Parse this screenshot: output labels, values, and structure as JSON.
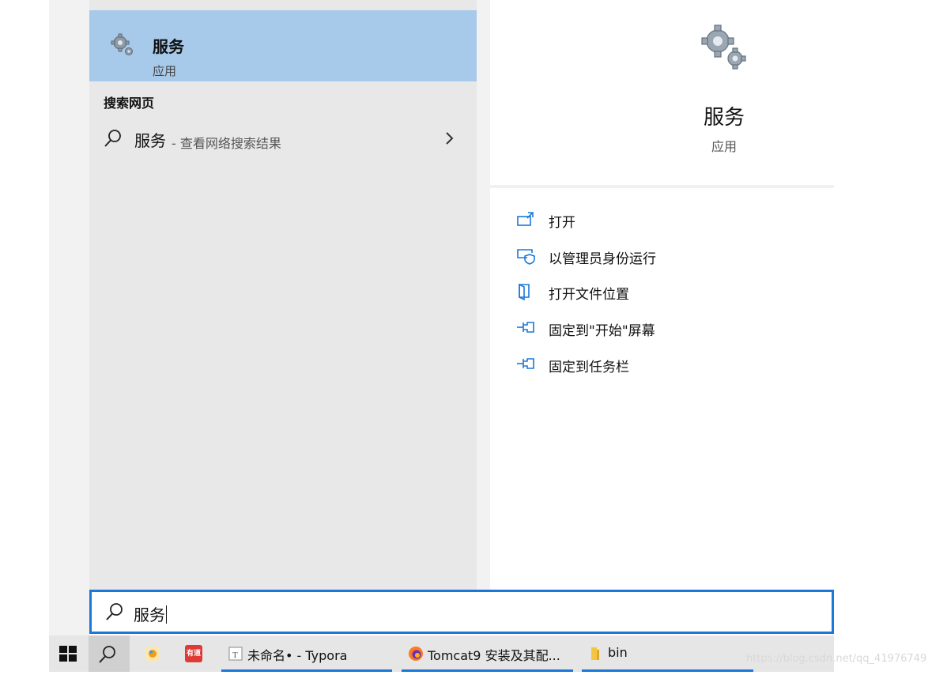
{
  "best_match": {
    "title": "服务",
    "subtitle": "应用"
  },
  "web_section": {
    "heading": "搜索网页",
    "term": "服务",
    "hint": "- 查看网络搜索结果"
  },
  "preview": {
    "title": "服务",
    "type": "应用",
    "actions": [
      {
        "label": "打开",
        "icon": "open-icon"
      },
      {
        "label": "以管理员身份运行",
        "icon": "run-as-admin-icon"
      },
      {
        "label": "打开文件位置",
        "icon": "file-location-icon"
      },
      {
        "label": "固定到\"开始\"屏幕",
        "icon": "pin-icon"
      },
      {
        "label": "固定到任务栏",
        "icon": "pin-icon"
      }
    ]
  },
  "search": {
    "query": "服务"
  },
  "taskbar": {
    "tasks": [
      {
        "label": "未命名• - Typora",
        "icon": "typora-icon"
      },
      {
        "label": "Tomcat9 安装及其配...",
        "icon": "firefox-icon"
      },
      {
        "label": "bin",
        "icon": "folder-icon"
      }
    ],
    "pins": [
      {
        "icon": "store-app-icon"
      },
      {
        "icon": "youdao-icon",
        "text": "有道"
      }
    ]
  },
  "watermark": "https://blog.csdn.net/qq_41976749",
  "colors": {
    "accent": "#1b78d7",
    "selection": "#a7c9ea",
    "left_pane": "#e8e8e8",
    "taskbar": "#e6e6e6"
  }
}
